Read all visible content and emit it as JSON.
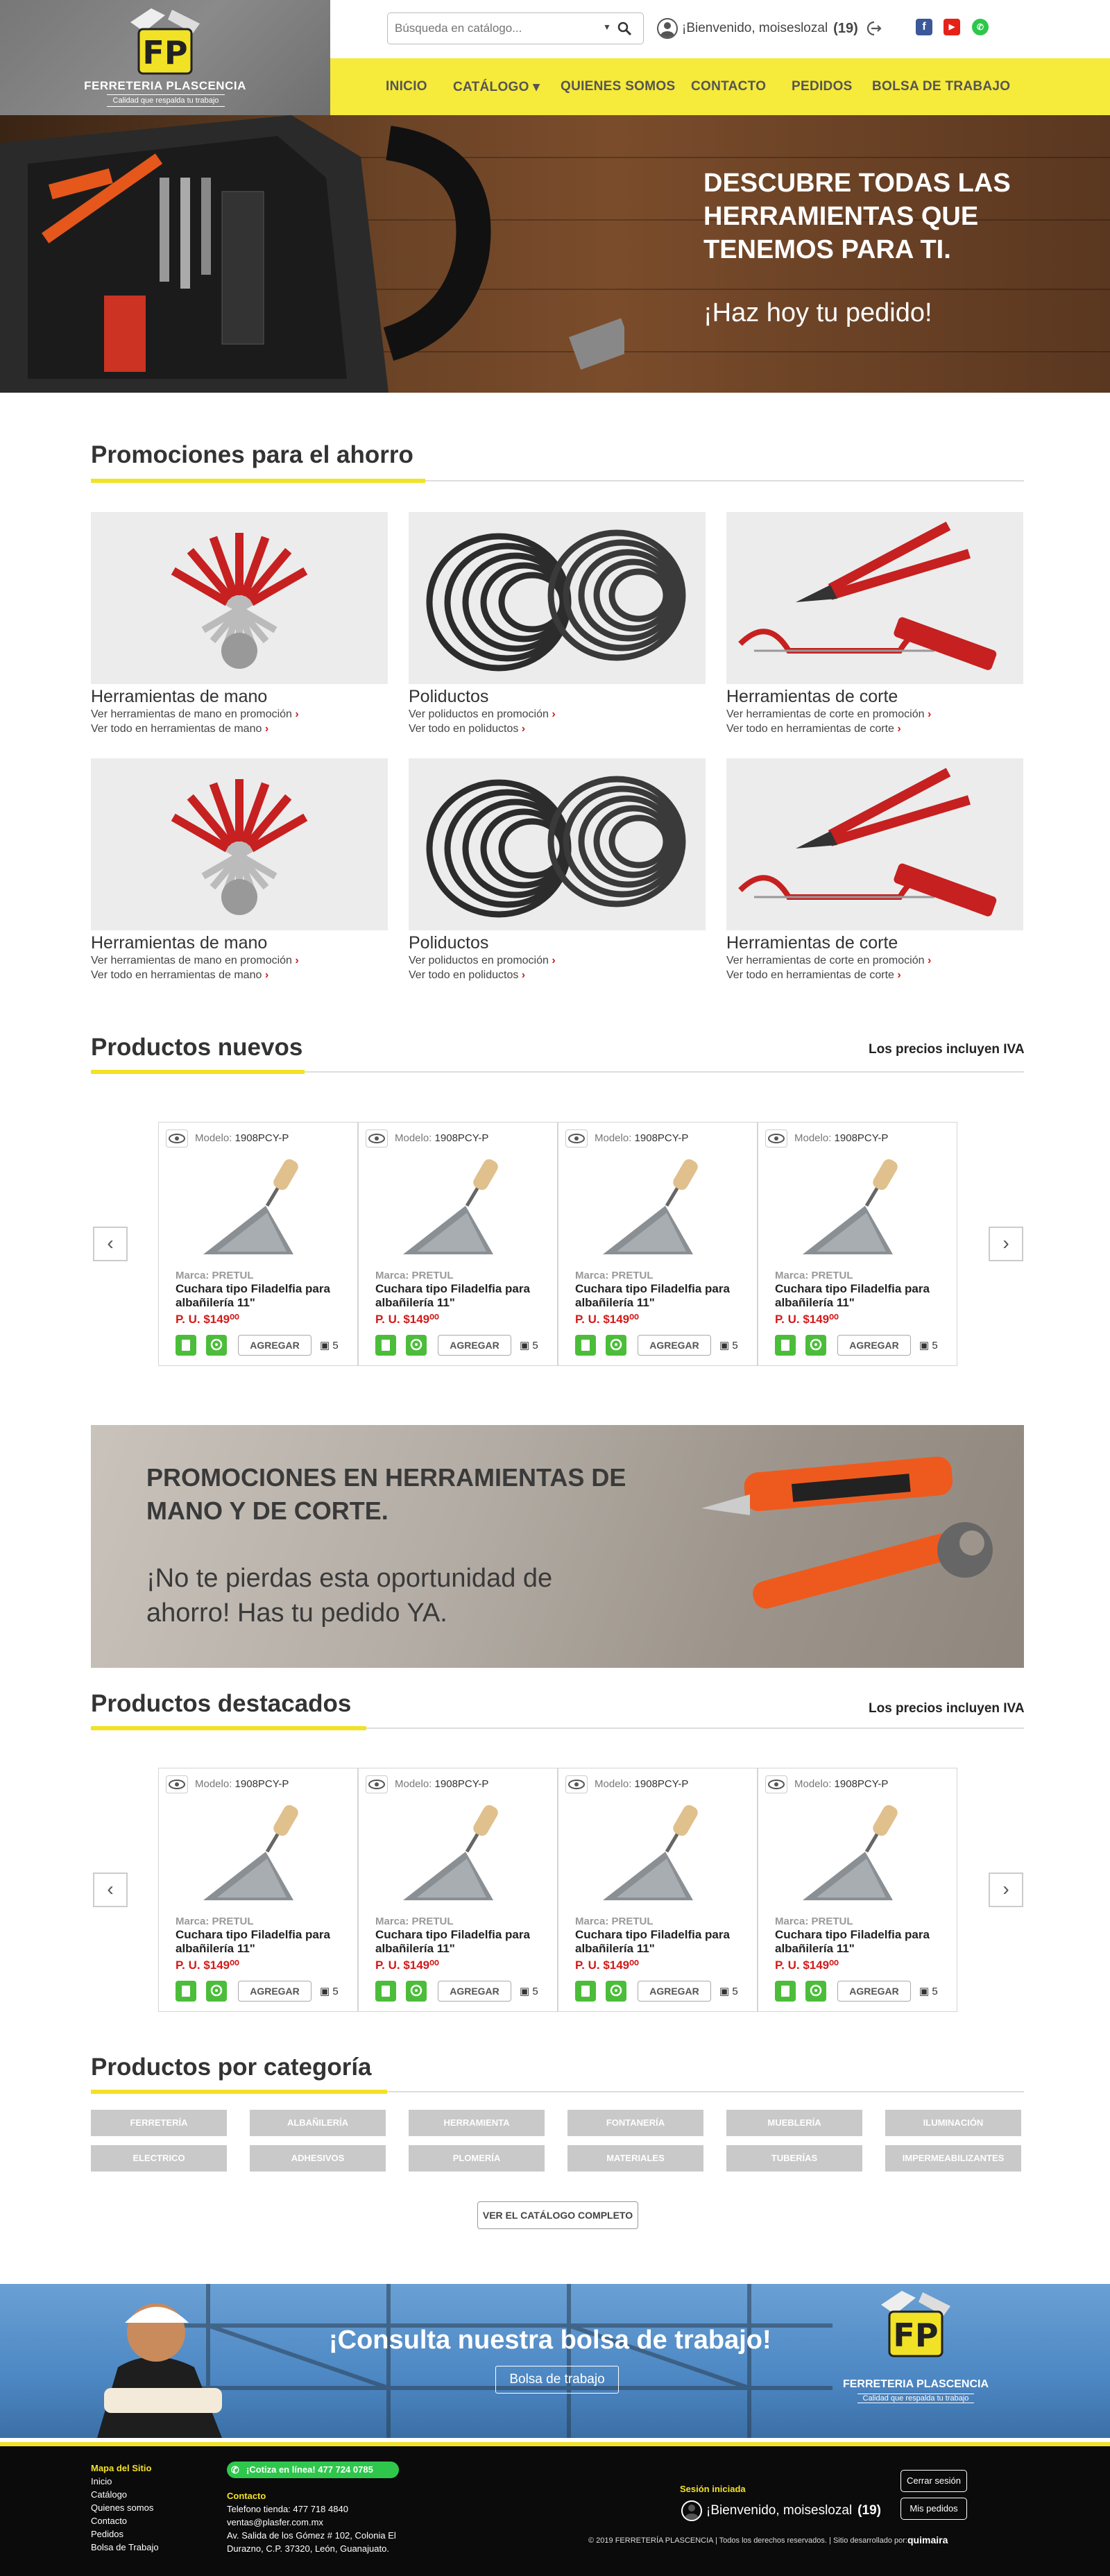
{
  "brand": {
    "name": "FERRETERIA PLASCENCIA",
    "tagline": "Calidad que respalda tu trabajo",
    "color_yellow": "#f2e225",
    "color_red": "#d21a1a",
    "color_green": "#4cbd3a"
  },
  "header": {
    "search_placeholder": "Búsqueda en catálogo...",
    "welcome": "¡Bienvenido, moiseslozal",
    "cart_count": "(19)",
    "icons": [
      "search-icon",
      "user-icon",
      "logout-icon",
      "facebook-icon",
      "youtube-icon",
      "whatsapp-icon"
    ]
  },
  "nav": [
    "INICIO",
    "CATÁLOGO ▾",
    "QUIENES SOMOS",
    "CONTACTO",
    "PEDIDOS",
    "BOLSA DE TRABAJO"
  ],
  "hero": {
    "headline": "DESCUBRE TODAS LAS HERRAMIENTAS QUE TENEMOS PARA TI.",
    "sub": "¡Haz hoy tu pedido!"
  },
  "promos": {
    "title": "Promociones para el ahorro",
    "cards": [
      {
        "name": "Herramientas de mano",
        "l1": "Ver herramientas de mano en promoción",
        "l2": "Ver todo en herramientas de mano"
      },
      {
        "name": "Poliductos",
        "l1": "Ver poliductos en promoción",
        "l2": "Ver todo en poliductos"
      },
      {
        "name": "Herramientas de corte",
        "l1": "Ver herramientas de corte en promoción",
        "l2": "Ver todo en herramientas de corte"
      },
      {
        "name": "Herramientas de mano",
        "l1": "Ver herramientas de mano en promoción",
        "l2": "Ver todo en herramientas de mano"
      },
      {
        "name": "Poliductos",
        "l1": "Ver poliductos en promoción",
        "l2": "Ver todo en poliductos"
      },
      {
        "name": "Herramientas de corte",
        "l1": "Ver herramientas de corte en promoción",
        "l2": "Ver todo en herramientas de corte"
      }
    ]
  },
  "iva": "Los precios incluyen IVA",
  "new_products": {
    "title": "Productos nuevos"
  },
  "featured_products": {
    "title": "Productos destacados"
  },
  "product": {
    "model_label": "Modelo:",
    "model": "1908PCY-P",
    "brand": "Marca: PRETUL",
    "name": "Cuchara tipo Filadelfia para albañilería 11\"",
    "price": "P. U. $149⁰⁰",
    "add": "AGREGAR",
    "stock": "5"
  },
  "banner": {
    "title": "PROMOCIONES EN HERRAMIENTAS DE MANO Y DE CORTE.",
    "text": "¡No te pierdas esta oportunidad de ahorro! Has tu pedido YA."
  },
  "categories": {
    "title": "Productos por categoría",
    "items": [
      "FERRETERÍA",
      "ALBAÑILERÍA",
      "HERRAMIENTA",
      "FONTANERÍA",
      "MUEBLERÍA",
      "ILUMINACIÓN",
      "ELECTRICO",
      "ADHESIVOS",
      "PLOMERÍA",
      "MATERIALES",
      "TUBERÍAS",
      "IMPERMEABILIZANTES"
    ],
    "button": "VER EL CATÁLOGO COMPLETO"
  },
  "jobs": {
    "title": "¡Consulta nuestra bolsa de trabajo!",
    "button": "Bolsa de trabajo"
  },
  "footer": {
    "sitemap_title": "Mapa del Sitio",
    "sitemap": [
      "Inicio",
      "Catálogo",
      "Quienes somos",
      "Contacto",
      "Pedidos",
      "Bolsa de Trabajo"
    ],
    "whatsapp": "¡Cotiza en línea! 477 724 0785",
    "contact_title": "Contacto",
    "contact": [
      "Telefono tienda: 477 718 4840",
      "ventas@plasfer.com.mx",
      "Av. Salida de los Gómez # 102, Colonia El",
      "Durazno, C.P. 37320, León, Guanajuato."
    ],
    "session_title": "Sesión iniciada",
    "session_user": "¡Bienvenido, moiseslozal",
    "session_count": "(19)",
    "logout": "Cerrar sesión",
    "orders": "Mis pedidos",
    "copyright": "© 2019 FERRETERÍA PLASCENCIA | Todos los derechos reservados. | Sitio desarrollado por:",
    "dev": "quimaira"
  }
}
